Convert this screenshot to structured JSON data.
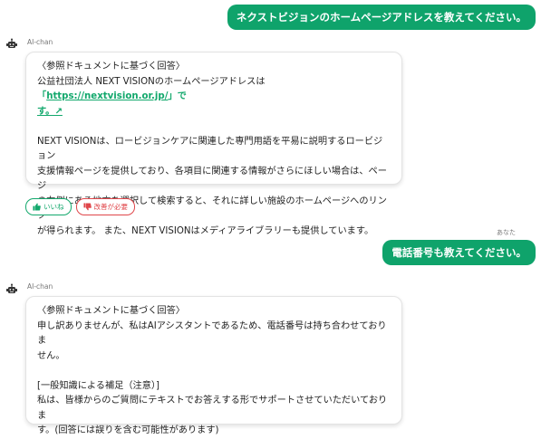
{
  "messages": {
    "user1": {
      "text": "ネクストビジョンのホームページアドレスを教えてください。"
    },
    "bot1": {
      "name": "AI-chan",
      "line1": "〈参照ドキュメントに基づく回答〉",
      "line2_pre": "公益社団法人 NEXT VISIONのホームページアドレスは",
      "line2_q_open": "「",
      "link": "https://nextvision.or.jp/",
      "line2_q_close": "」で",
      "line3_tail": "す。↗",
      "para2": [
        "NEXT VISIONは、ロービジョンケアに関連した専門用語を平易に説明するロービジョン",
        "支援情報ページを提供しており、各項目に関連する情報がさらにほしい場合は、ページ",
        "の右側にある地方を選択して検索すると、それに詳しい施設のホームページへのリンク",
        "が得られます。 また、NEXT VISIONはメディアライブラリーも提供しています。"
      ],
      "feedback": {
        "like": "いいね",
        "improve": "改善が必要"
      }
    },
    "user2": {
      "label": "あなた",
      "text": "電話番号も教えてください。"
    },
    "bot2": {
      "name": "AI-chan",
      "line1": "〈参照ドキュメントに基づく回答〉",
      "para1": [
        "申し訳ありませんが、私はAIアシスタントであるため、電話番号は持ち合わせておりま",
        "せん。"
      ],
      "para2": [
        "[一般知識による補足（注意）]",
        "私は、皆様からのご質問にテキストでお答えする形でサポートさせていただいておりま",
        "す。(回答には誤りを含む可能性があります)"
      ]
    }
  },
  "colors": {
    "accent": "#0fa36b",
    "danger": "#e0464a"
  },
  "icons": {
    "bot": "robot-icon",
    "like": "thumbs-up-icon",
    "improve": "thumbs-down-icon"
  }
}
